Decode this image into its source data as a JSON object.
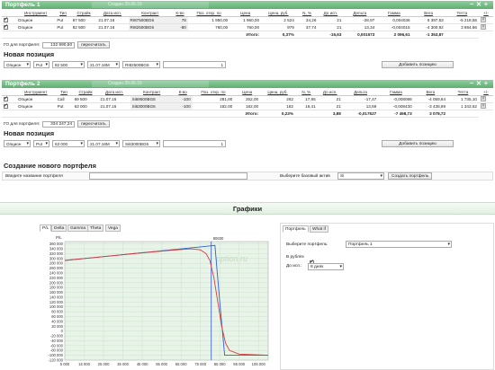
{
  "portfolios": [
    {
      "title": "Портфель 1",
      "created": "Создан 20.06.16",
      "icons": [
        "minus-icon",
        "close-icon",
        "plus-icon"
      ],
      "columns": [
        "Инструмент",
        "Тип",
        "Страйк",
        "Дата исп.",
        "Контракт",
        "К-во",
        "Поз. откр. по",
        "Цена",
        "Цена, руб.",
        "N, %",
        "До исп.",
        "Дельта",
        "Гамма",
        "Вега",
        "Тетта",
        "+/-"
      ],
      "rows": [
        [
          "Опцион",
          "Put",
          "87 500",
          "21.07.16",
          "RI87500BG6",
          "78",
          "1 950,00",
          "1 960,00",
          "2 524",
          "34,26",
          "21",
          "-28,97",
          "0,004036",
          "6 397,53",
          "-5 218,58"
        ],
        [
          "Опцион",
          "Put",
          "82 500",
          "21.07.16",
          "RI82500BG6",
          "-80",
          "760,00",
          "760,00",
          "979",
          "37,74",
          "21",
          "13,34",
          "-0,004015",
          "-4 300,92",
          "3 864,66"
        ]
      ],
      "total": {
        "label": "Итого:",
        "pct": "0,37%",
        "delta": "-15,63",
        "gamma": "0,001573",
        "vega": "2 096,61",
        "theta": "-1 353,87"
      },
      "go_label": "ГО для портфеля:",
      "go_value": "132 590,50",
      "recalc_label": "пересчитать",
      "new_pos_title": "Новая позиция",
      "form": {
        "instrument": "Опцион",
        "type": "Put",
        "strike": "82 500",
        "date": "21.07.16M",
        "contract": "RI82500BG6",
        "qty": "1",
        "add_label": "Добавить позицию"
      }
    },
    {
      "title": "Портфель 2",
      "created": "Создан 20.06.16",
      "icons": [
        "minus-icon",
        "close-icon",
        "plus-icon"
      ],
      "columns": [
        "Инструмент",
        "Тип",
        "Страйк",
        "Дата исп.",
        "Контракт",
        "К-во",
        "Поз. откр. по",
        "Цена",
        "Цена, руб.",
        "N, %",
        "До исп.",
        "Дельта",
        "Гамма",
        "Вега",
        "Тетта",
        "+/-"
      ],
      "rows": [
        [
          "Опцион",
          "Call",
          "69 500",
          "21.07.16",
          "Si69500BG6",
          "-100",
          "281,00",
          "262,00",
          "262",
          "17,95",
          "21",
          "-17,47",
          "-0,008098",
          "-4 059,84",
          "1 735,10"
        ],
        [
          "Опцион",
          "Put",
          "63 000",
          "21.07.16",
          "Si63000BG6",
          "-100",
          "182,00",
          "182,00",
          "182",
          "16,41",
          "21",
          "13,59",
          "-0,008430",
          "-3 438,89",
          "1 343,62"
        ]
      ],
      "total": {
        "label": "Итого:",
        "pct": "0,23%",
        "delta": "3,88",
        "gamma": "-0,017527",
        "vega": "-7 498,73",
        "theta": "3 078,72"
      },
      "go_label": "ГО для портфеля:",
      "go_value": "334 247,24",
      "recalc_label": "пересчитать",
      "new_pos_title": "Новая позиция",
      "form": {
        "instrument": "Опцион",
        "type": "Put",
        "strike": "63 000",
        "date": "21.07.16M",
        "contract": "Si63000BG6",
        "qty": "1",
        "add_label": "Добавить позицию"
      }
    }
  ],
  "create": {
    "title": "Создание нового портфеля",
    "name_label": "Введите название портфеля",
    "name_value": "",
    "asset_label": "Выберите базовый актив",
    "asset_value": "Si",
    "button": "Создать портфель"
  },
  "charts_title": "Графики",
  "chart_tabs": [
    "P/L",
    "Delta",
    "Gamma",
    "Theta",
    "Vega"
  ],
  "chart_tab_active": "P/L",
  "side_tabs": [
    "Портфель",
    "What if"
  ],
  "side": {
    "portfolio_label": "Выберите портфель:",
    "portfolio_value": "Портфель 1",
    "rub_label": "В рублях",
    "rub_checked": true,
    "exp_label": "До исп.:",
    "exp_value": "8 днях"
  },
  "colors": {
    "header": "#6dbb7f",
    "expiry_line": "#2f5fd6",
    "current_line": "#d83b3b",
    "marker": "#3355cc",
    "plot_bg": "#e8f4e8"
  },
  "chart_data": {
    "type": "line",
    "ylabel": "P/L",
    "watermark": "option.ru",
    "xlim": [
      5000,
      110000
    ],
    "ylim": [
      -120000,
      370000
    ],
    "grid": true,
    "x_ticks": [
      "5 000",
      "15 000",
      "25 000",
      "35 000",
      "45 000",
      "55 000",
      "65 000",
      "75 000",
      "85 000",
      "95 000",
      "105 000"
    ],
    "x_tick_values": [
      5000,
      15000,
      25000,
      35000,
      45000,
      55000,
      65000,
      75000,
      85000,
      95000,
      105000
    ],
    "y_ticks": [
      "360 000",
      "340 000",
      "320 000",
      "300 000",
      "280 000",
      "260 000",
      "240 000",
      "220 000",
      "200 000",
      "180 000",
      "160 000",
      "140 000",
      "120 000",
      "100 000",
      "80 000",
      "60 000",
      "40 000",
      "20 000",
      "0",
      "-20 000",
      "-40 000",
      "-60 000",
      "-80 000",
      "-100 000",
      "-120 000"
    ],
    "y_tick_values": [
      360000,
      340000,
      320000,
      300000,
      280000,
      260000,
      240000,
      220000,
      200000,
      180000,
      160000,
      140000,
      120000,
      100000,
      80000,
      60000,
      40000,
      20000,
      0,
      -20000,
      -40000,
      -60000,
      -80000,
      -100000,
      -120000
    ],
    "marker": {
      "x": 80600,
      "label": "80600"
    },
    "series": [
      {
        "x": [
          5000,
          20000,
          40000,
          60000,
          75000,
          80000,
          82500,
          85000,
          87500,
          95000,
          110000
        ],
        "y": [
          292000,
          304000,
          320000,
          336000,
          348000,
          352000,
          354000,
          120000,
          -100000,
          -100000,
          -100000
        ]
      },
      {
        "x": [
          5000,
          20000,
          40000,
          60000,
          70000,
          75000,
          78000,
          80000,
          82000,
          84000,
          86000,
          88000,
          90000,
          95000,
          110000
        ],
        "y": [
          292000,
          304000,
          320000,
          334000,
          340000,
          336000,
          320000,
          290000,
          220000,
          120000,
          20000,
          -50000,
          -80000,
          -95000,
          -100000
        ]
      }
    ]
  }
}
